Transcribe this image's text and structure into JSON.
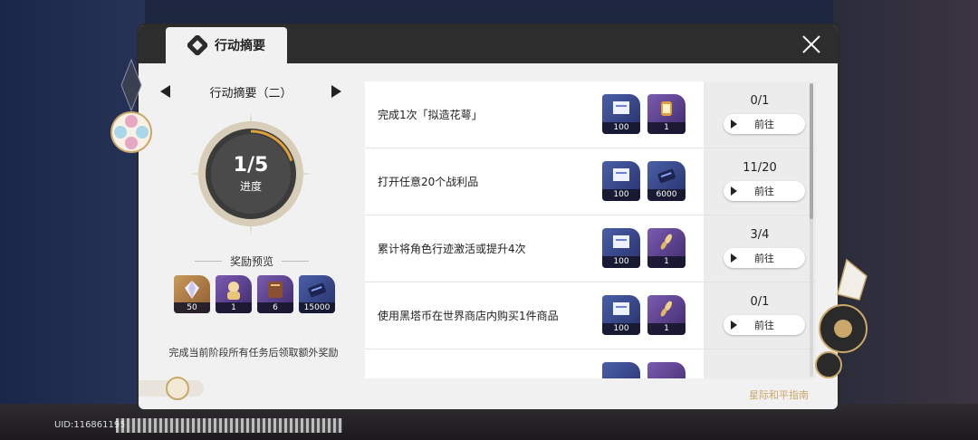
{
  "header": {
    "tab_label": "行动摘要",
    "tab_icon": "action-summary-icon",
    "close_icon": "close-icon"
  },
  "stage": {
    "title": "行动摘要（二）",
    "progress_count": "1/5",
    "progress_fraction": 0.2,
    "progress_label": "进度"
  },
  "rewards_preview": {
    "title": "奖励预览",
    "items": [
      {
        "icon": "crystal-icon",
        "qty": "50",
        "rarity": "gold"
      },
      {
        "icon": "character-icon",
        "qty": "1",
        "rarity": "purple"
      },
      {
        "icon": "book-icon",
        "qty": "6",
        "rarity": "purple"
      },
      {
        "icon": "credit-icon",
        "qty": "15000",
        "rarity": "blue"
      }
    ]
  },
  "footer_note": "完成当前阶段所有任务后领取额外奖励",
  "tasks": [
    {
      "text": "完成1次「拟造花萼」",
      "rewards": [
        {
          "icon": "ticket-icon",
          "qty": "100"
        },
        {
          "icon": "lantern-icon",
          "qty": "1"
        }
      ],
      "progress": "0/1",
      "button": "前往"
    },
    {
      "text": "打开任意20个战利品",
      "rewards": [
        {
          "icon": "ticket-icon",
          "qty": "100"
        },
        {
          "icon": "credit-icon",
          "qty": "6000"
        }
      ],
      "progress": "11/20",
      "button": "前往"
    },
    {
      "text": "累计将角色行迹激活或提升4次",
      "rewards": [
        {
          "icon": "ticket-icon",
          "qty": "100"
        },
        {
          "icon": "feather-icon",
          "qty": "1"
        }
      ],
      "progress": "3/4",
      "button": "前往"
    },
    {
      "text": "使用黑塔币在世界商店内购买1件商品",
      "rewards": [
        {
          "icon": "ticket-icon",
          "qty": "100"
        },
        {
          "icon": "feather-icon",
          "qty": "1"
        }
      ],
      "progress": "0/1",
      "button": "前往"
    }
  ],
  "guide_label": "星际和平指南",
  "uid_label": "UID:116861195",
  "colors": {
    "accent": "#c9a86a",
    "ring_progress": "#e0a13a",
    "titlebar": "#2d2d2d"
  }
}
